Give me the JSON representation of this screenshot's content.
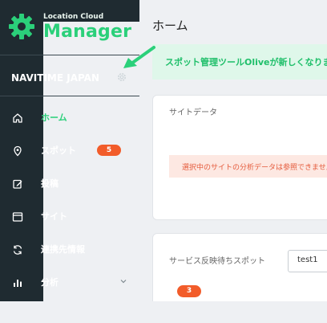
{
  "sidebar": {
    "brand": {
      "sub": "Location Cloud",
      "main": "Manager"
    },
    "account_name": "NAVITIME JAPAN",
    "items": [
      {
        "label": "ホーム",
        "icon": "home-icon"
      },
      {
        "label": "スポット",
        "icon": "location-pin-icon",
        "badge": "5"
      },
      {
        "label": "投稿",
        "icon": "edit-icon"
      },
      {
        "label": "サイト",
        "icon": "site-icon"
      },
      {
        "label": "連携先情報",
        "icon": "sync-icon"
      },
      {
        "label": "分析",
        "icon": "bar-chart-icon"
      }
    ]
  },
  "main": {
    "page_title": "ホーム",
    "notice": "スポット管理ツールOliveが新しくなりました",
    "site_card": {
      "title": "サイトデータ",
      "alert": "選択中のサイトの分析データは参照できません"
    },
    "pending_card": {
      "title": "サービス反映待ちスポット",
      "select_value": "test1",
      "count": "3"
    }
  },
  "colors": {
    "sidebar": "#1f2b31",
    "accent_green": "#2bd07a",
    "badge_orange": "#f25c2a",
    "notice_bg": "#dff7ea",
    "alert_bg": "#fde8e2"
  }
}
